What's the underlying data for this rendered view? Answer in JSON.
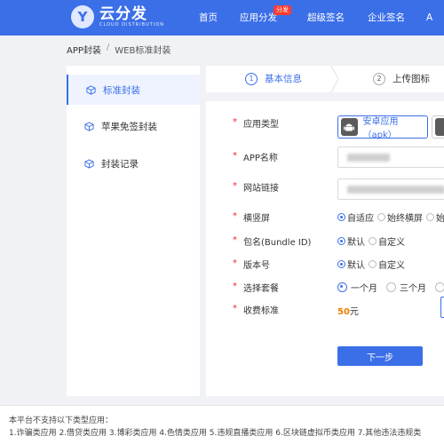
{
  "header": {
    "logo_letter": "Y",
    "logo_name": "云分发",
    "logo_sub": "CLOUD DISTRIBUTION",
    "nav": [
      {
        "label": "首页"
      },
      {
        "label": "应用分发",
        "badge": "分发"
      },
      {
        "label": "超级签名"
      },
      {
        "label": "企业签名"
      },
      {
        "label": "A"
      }
    ]
  },
  "breadcrumb": {
    "root": "APP封装",
    "separator": "/",
    "current": "WEB标准封装"
  },
  "sidebar": {
    "items": [
      {
        "label": "标准封装",
        "icon": "cube-icon",
        "active": true
      },
      {
        "label": "苹果免签封装",
        "icon": "cube-icon",
        "active": false
      },
      {
        "label": "封装记录",
        "icon": "cube-icon",
        "active": false
      }
    ]
  },
  "steps": [
    {
      "num": "1",
      "label": "基本信息",
      "active": true
    },
    {
      "num": "2",
      "label": "上传图标",
      "active": false
    }
  ],
  "form": {
    "app_type": {
      "label": "应用类型",
      "options": [
        {
          "label": "安卓应用（apk）",
          "icon": "android-icon",
          "selected": true
        },
        {
          "label": "",
          "icon": "apple-icon",
          "selected": false
        }
      ]
    },
    "app_name": {
      "label": "APP名称",
      "value": ""
    },
    "site_url": {
      "label": "网站链接",
      "value": ""
    },
    "orientation": {
      "label": "横竖屏",
      "options": [
        {
          "label": "自适应",
          "selected": true
        },
        {
          "label": "始终横屏",
          "selected": false
        },
        {
          "label": "始",
          "selected": false
        }
      ]
    },
    "bundle_id": {
      "label": "包名(Bundle ID)",
      "options": [
        {
          "label": "默认",
          "selected": true
        },
        {
          "label": "自定义",
          "selected": false
        }
      ]
    },
    "version": {
      "label": "版本号",
      "options": [
        {
          "label": "默认",
          "selected": true
        },
        {
          "label": "自定义",
          "selected": false
        }
      ]
    },
    "package": {
      "label": "选择套餐",
      "options": [
        {
          "label": "一个月",
          "selected": true
        },
        {
          "label": "三个月",
          "selected": false
        },
        {
          "label": "",
          "selected": false
        }
      ]
    },
    "fee": {
      "label": "收费标准",
      "amount": "50",
      "unit": "元"
    },
    "next_label": "下一步"
  },
  "notice": {
    "title": "本平台不支持以下类型应用：",
    "line1": "1.诈骗类应用 2.借贷类应用 3.博彩类应用 4.色情类应用 5.违规直播类应用 6.区块链虚拟币类应用 7.其他违法违规类"
  },
  "colors": {
    "accent": "#3b6fe8",
    "required": "#f5222d",
    "price": "#f07c00",
    "badge": "#ff3b30"
  }
}
